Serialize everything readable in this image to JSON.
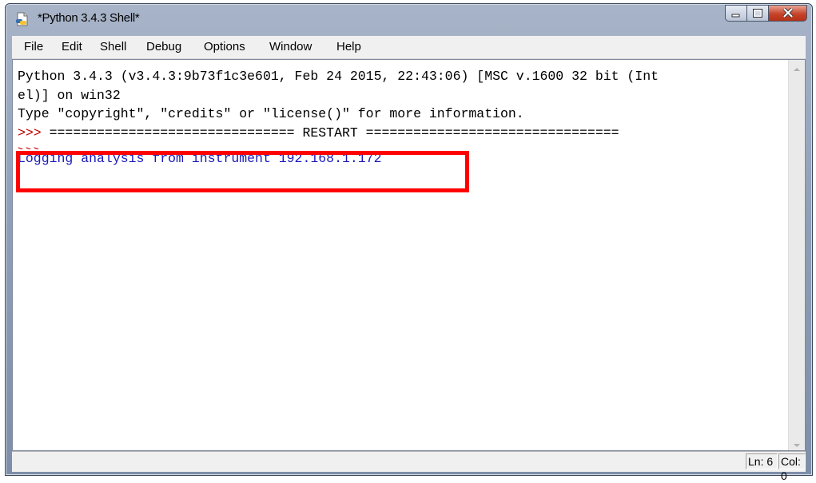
{
  "window": {
    "title": "*Python 3.4.3 Shell*"
  },
  "menu": {
    "items": [
      "File",
      "Edit",
      "Shell",
      "Debug",
      "Options",
      "Window",
      "Help"
    ]
  },
  "shell": {
    "line1": "Python 3.4.3 (v3.4.3:9b73f1c3e601, Feb 24 2015, 22:43:06) [MSC v.1600 32 bit (Int",
    "line2": "el)] on win32",
    "line3": "Type \"copyright\", \"credits\" or \"license()\" for more information.",
    "prompt": ">>> ",
    "restart_line": "=============================== RESTART ================================",
    "prompt2": ">>>",
    "output_line": "Logging analysis from instrument 192.168.1.172"
  },
  "status": {
    "line": "Ln: 6",
    "col": "Col: 0"
  },
  "colors": {
    "prompt": "#c00000",
    "output": "#1a1ab8",
    "highlight_border": "#ff0000"
  },
  "icons": [
    "python-file-icon",
    "minimize-icon",
    "maximize-icon",
    "close-icon",
    "scroll-up-arrow-icon",
    "scroll-down-arrow-icon"
  ]
}
